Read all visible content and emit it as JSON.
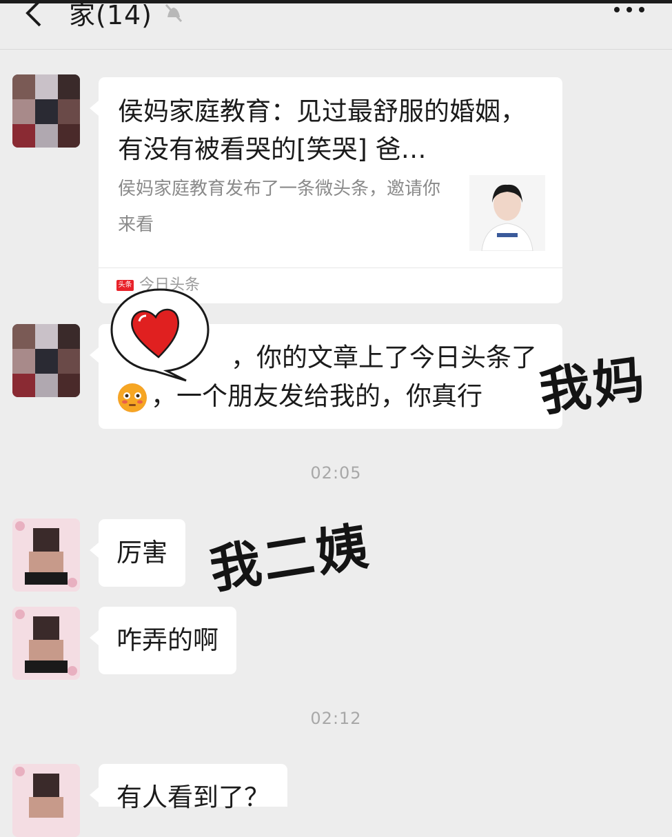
{
  "header": {
    "title": "家(14)",
    "icons": [
      "back-arrow-icon",
      "mute-bell-icon",
      "more-icon"
    ]
  },
  "messages": [
    {
      "sender_avatar": "avatar-mom",
      "type": "link-card",
      "title": "侯妈家庭教育：见过最舒服的婚姻，有没有被看哭的[笑哭] 爸…",
      "description": "侯妈家庭教育发布了一条微头条，邀请你来看",
      "source_logo": "头条",
      "source": "今日头条"
    },
    {
      "sender_avatar": "avatar-mom",
      "type": "text",
      "line1": "，你的文章上了今日头条了",
      "line2": "，一个朋友发给我的，你真行",
      "emoji": "flushed-face-icon"
    },
    {
      "type": "time",
      "text": "02:05"
    },
    {
      "sender_avatar": "avatar-aunt",
      "type": "text",
      "text": "厉害"
    },
    {
      "sender_avatar": "avatar-aunt",
      "type": "text",
      "text": "咋弄的啊"
    },
    {
      "type": "time",
      "text": "02:12"
    },
    {
      "sender_avatar": "avatar-aunt",
      "type": "text",
      "text": "有人看到了？"
    }
  ],
  "annotations": {
    "mom": "我妈",
    "aunt": "我二姨"
  },
  "colors": {
    "background": "#ededed",
    "bubble": "#ffffff",
    "timestamp": "#a8a8a8",
    "heart": "#e02020"
  }
}
